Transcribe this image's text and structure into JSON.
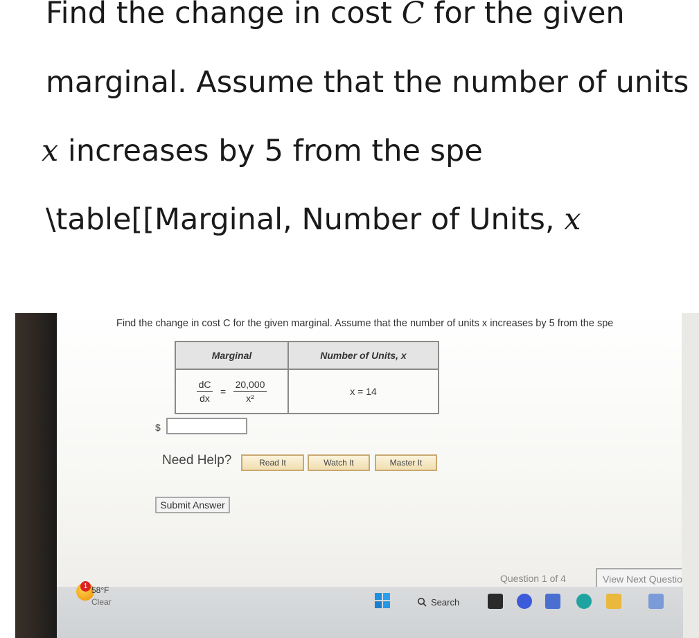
{
  "question": {
    "line1_a": "Find the change in cost ",
    "line1_var": "C",
    "line1_b": " for the given",
    "line2": "marginal. Assume that the number of units",
    "line3_var": "x",
    "line3_a": " increases by ",
    "line3_num": "5",
    "line3_b": " from the spe",
    "line4_a": "\\table[[Marginal, Number of Units, ",
    "line4_var": "x"
  },
  "screen": {
    "question_text": "Find the change in cost C for the given marginal. Assume that the number of units x increases by 5 from the spe",
    "table": {
      "header_marginal": "Marginal",
      "header_units": "Number of Units, x",
      "marginal_lhs_num": "dC",
      "marginal_lhs_den": "dx",
      "marginal_eq": "=",
      "marginal_rhs_num": "20,000",
      "marginal_rhs_den": "x²",
      "units_value": "x = 14"
    },
    "answer_prefix": "$",
    "answer_value": "",
    "need_help": "Need Help?",
    "help_buttons": {
      "read": "Read It",
      "watch": "Watch It",
      "master": "Master It"
    },
    "submit": "Submit Answer",
    "question_counter": "Question 1 of 4",
    "next_question": "View Next Question"
  },
  "taskbar": {
    "weather_badge": "1",
    "temperature": "58°F",
    "condition": "Clear",
    "search_label": "Search",
    "icons": [
      "task-view-icon",
      "chat-icon",
      "store-icon",
      "edge-icon",
      "file-explorer-icon",
      "mcafee-icon"
    ]
  },
  "colors": {
    "help_button_bg": "#f1dfb0",
    "help_button_border": "#c9a870",
    "table_border": "#8a8a8a",
    "taskbar_bg": "#d3d5d7"
  }
}
